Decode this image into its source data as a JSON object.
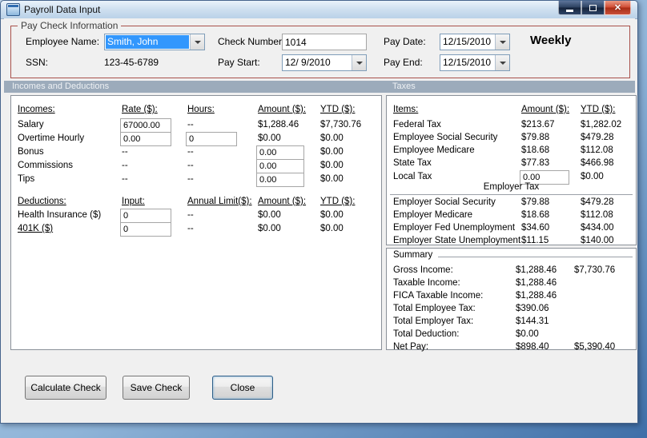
{
  "window": {
    "title": "Payroll Data Input"
  },
  "icons": {
    "close": "✕",
    "dropdown": "▼"
  },
  "colors": {
    "group_border": "#a8504a",
    "selection_bg": "#3297fd",
    "band_bg": "#9cabbb",
    "band_text": "#eef1f4"
  },
  "paycheck": {
    "group_label": "Pay Check Information",
    "employee_name": {
      "label": "Employee Name:",
      "value": "Smith, John"
    },
    "ssn": {
      "label": "SSN:",
      "value": "123-45-6789"
    },
    "check_number": {
      "label": "Check Number:",
      "value": "1014"
    },
    "pay_start": {
      "label": "Pay Start:",
      "value": "12/ 9/2010"
    },
    "pay_date": {
      "label": "Pay Date:",
      "value": "12/15/2010"
    },
    "pay_end": {
      "label": "Pay End:",
      "value": "12/15/2010"
    },
    "frequency": "Weekly"
  },
  "sections": {
    "incomes_deductions": "Incomes and Deductions",
    "taxes": "Taxes",
    "employer_tax": "Employer Tax",
    "summary": "Summary"
  },
  "incomes": {
    "headers": {
      "name": "Incomes:",
      "rate": "Rate ($):",
      "hours": "Hours:",
      "amount": "Amount ($):",
      "ytd": "YTD ($):"
    },
    "salary": {
      "label": "Salary",
      "rate": "67000.00",
      "hours": "--",
      "amount": "$1,288.46",
      "ytd": "$7,730.76"
    },
    "overtime": {
      "label": "Overtime Hourly",
      "rate": "0.00",
      "hours": "0",
      "amount": "$0.00",
      "ytd": "$0.00"
    },
    "bonus": {
      "label": "Bonus",
      "rate": "--",
      "hours": "--",
      "amount": "0.00",
      "ytd": "$0.00"
    },
    "commissions": {
      "label": "Commissions",
      "rate": "--",
      "hours": "--",
      "amount": "0.00",
      "ytd": "$0.00"
    },
    "tips": {
      "label": "Tips",
      "rate": "--",
      "hours": "--",
      "amount": "0.00",
      "ytd": "$0.00"
    }
  },
  "deductions": {
    "headers": {
      "name": "Deductions:",
      "input": "Input:",
      "limit": "Annual Limit($):",
      "amount": "Amount ($):",
      "ytd": "YTD ($):"
    },
    "health": {
      "label": "Health Insurance  ($)",
      "input": "0",
      "limit": "--",
      "amount": "$0.00",
      "ytd": "$0.00"
    },
    "k401": {
      "label": "401K  ($)",
      "input": "0",
      "limit": "--",
      "amount": "$0.00",
      "ytd": "$0.00"
    }
  },
  "taxes": {
    "headers": {
      "items": "Items:",
      "amount": "Amount ($):",
      "ytd": "YTD ($):"
    },
    "rows": [
      {
        "label": "Federal Tax",
        "amount": "$213.67",
        "ytd": "$1,282.02"
      },
      {
        "label": "Employee Social Security",
        "amount": "$79.88",
        "ytd": "$479.28"
      },
      {
        "label": "Employee Medicare",
        "amount": "$18.68",
        "ytd": "$112.08"
      },
      {
        "label": "State Tax",
        "amount": "$77.83",
        "ytd": "$466.98"
      }
    ],
    "local": {
      "label": "Local Tax",
      "amount": "0.00",
      "ytd": "$0.00"
    },
    "employer_rows": [
      {
        "label": "Employer Social Security",
        "amount": "$79.88",
        "ytd": "$479.28"
      },
      {
        "label": "Employer Medicare",
        "amount": "$18.68",
        "ytd": "$112.08"
      },
      {
        "label": "Employer Fed Unemployment",
        "amount": "$34.60",
        "ytd": "$434.00"
      },
      {
        "label": "Employer State Unemployment",
        "amount": "$11.15",
        "ytd": "$140.00"
      }
    ]
  },
  "summary": {
    "rows": [
      {
        "label": "Gross Income:",
        "v1": "$1,288.46",
        "v2": "$7,730.76"
      },
      {
        "label": "Taxable Income:",
        "v1": "$1,288.46",
        "v2": ""
      },
      {
        "label": "FICA Taxable Income:",
        "v1": "$1,288.46",
        "v2": ""
      },
      {
        "label": "Total Employee Tax:",
        "v1": "$390.06",
        "v2": ""
      },
      {
        "label": "Total Employer Tax:",
        "v1": "$144.31",
        "v2": ""
      },
      {
        "label": "Total Deduction:",
        "v1": "$0.00",
        "v2": ""
      },
      {
        "label": "Net Pay:",
        "v1": "$898.40",
        "v2": "$5,390.40"
      }
    ]
  },
  "buttons": {
    "calculate": "Calculate Check",
    "save": "Save Check",
    "close": "Close"
  }
}
